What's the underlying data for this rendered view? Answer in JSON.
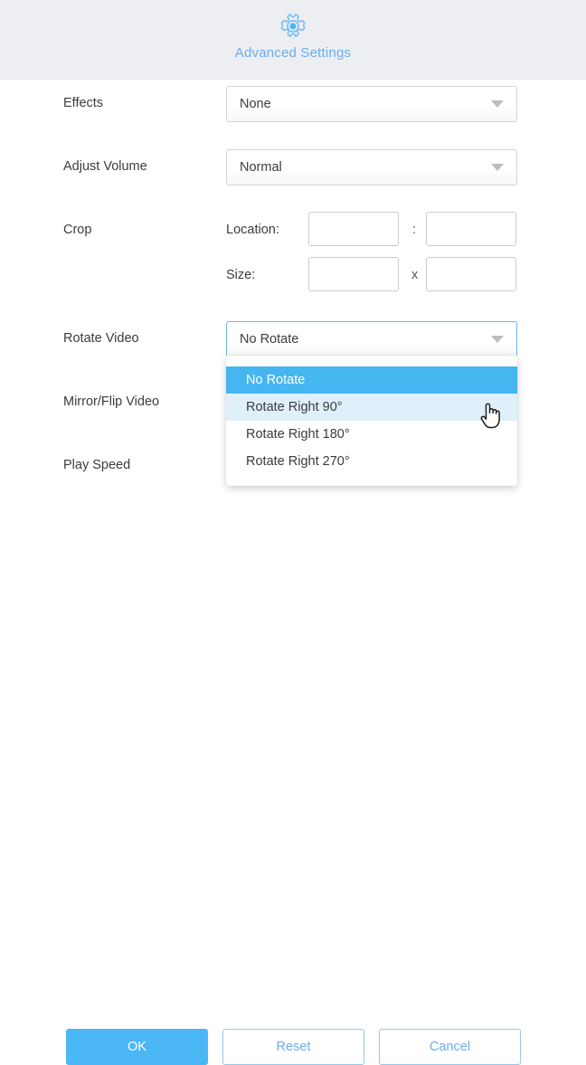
{
  "header": {
    "icon": "gear-settings-icon",
    "title": "Advanced Settings"
  },
  "form": {
    "rows": [
      {
        "label": "Effects",
        "value": "None"
      },
      {
        "label": "Adjust Volume",
        "value": "Normal"
      },
      {
        "label": "Crop"
      },
      {
        "label": "Rotate Video",
        "value": "No Rotate"
      },
      {
        "label": "Mirror/Flip Video"
      },
      {
        "label": "Play Speed"
      }
    ],
    "crop": {
      "location_label": "Location:",
      "location_separator": ":",
      "location_x_value": "",
      "location_y_value": "",
      "size_label": "Size:",
      "size_separator": "x",
      "size_w_value": "",
      "size_h_value": ""
    }
  },
  "rotate_dropdown": {
    "open": true,
    "selected": "No Rotate",
    "hovered": "Rotate Right 90°",
    "options": [
      "No Rotate",
      "Rotate Right 90°",
      "Rotate Right 180°",
      "Rotate Right 270°"
    ]
  },
  "footer": {
    "ok_label": "OK",
    "reset_label": "Reset",
    "cancel_label": "Cancel"
  },
  "cursor": {
    "type": "pointing-hand-cursor"
  },
  "colors": {
    "header_bg": "#edeef2",
    "accent": "#4cb7f5",
    "accent_text": "#6cadea",
    "dropdown_selected_bg": "#46b6f0",
    "dropdown_hover_bg": "#dff0fb",
    "text": "#3c3c3c",
    "border": "#d2d4d6"
  }
}
